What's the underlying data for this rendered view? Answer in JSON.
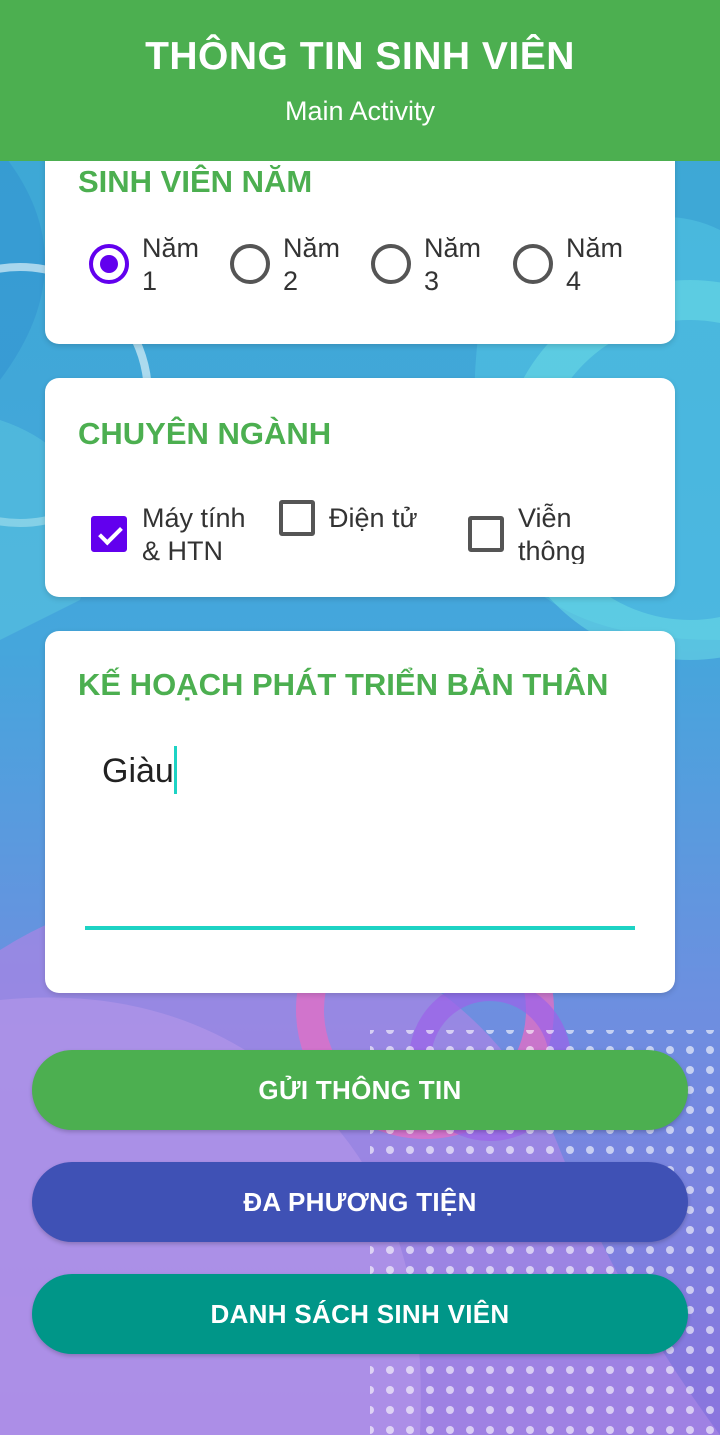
{
  "app": {
    "title": "THÔNG TIN SINH VIÊN",
    "subtitle": "Main Activity",
    "accent_color": "#4caf50"
  },
  "year_section": {
    "title": "SINH VIÊN NĂM",
    "options": [
      {
        "label": "Năm 1",
        "line1": "Năm",
        "line2": "1",
        "selected": true
      },
      {
        "label": "Năm 2",
        "line1": "Năm",
        "line2": "2",
        "selected": false
      },
      {
        "label": "Năm 3",
        "line1": "Năm",
        "line2": "3",
        "selected": false
      },
      {
        "label": "Năm 4",
        "line1": "Năm",
        "line2": "4",
        "selected": false
      }
    ]
  },
  "major_section": {
    "title": "CHUYÊN NGÀNH",
    "options": [
      {
        "label": "Máy tính & HTN",
        "line1": "Máy tính",
        "line2": "& HTN",
        "checked": true
      },
      {
        "label": "Điện tử",
        "line1": "Điện tử",
        "line2": "",
        "checked": false
      },
      {
        "label": "Viễn thông",
        "line1": "Viễn",
        "line2": "thông",
        "checked": false
      }
    ]
  },
  "plan_section": {
    "title": "KẾ HOẠCH PHÁT TRIỂN BẢN THÂN",
    "value": "Giàu"
  },
  "buttons": {
    "send": {
      "label": "GỬI THÔNG TIN",
      "color": "#4caf50"
    },
    "media": {
      "label": "ĐA PHƯƠNG TIỆN",
      "color": "#3f51b5"
    },
    "list": {
      "label": "DANH SÁCH SINH VIÊN",
      "color": "#009688"
    }
  }
}
